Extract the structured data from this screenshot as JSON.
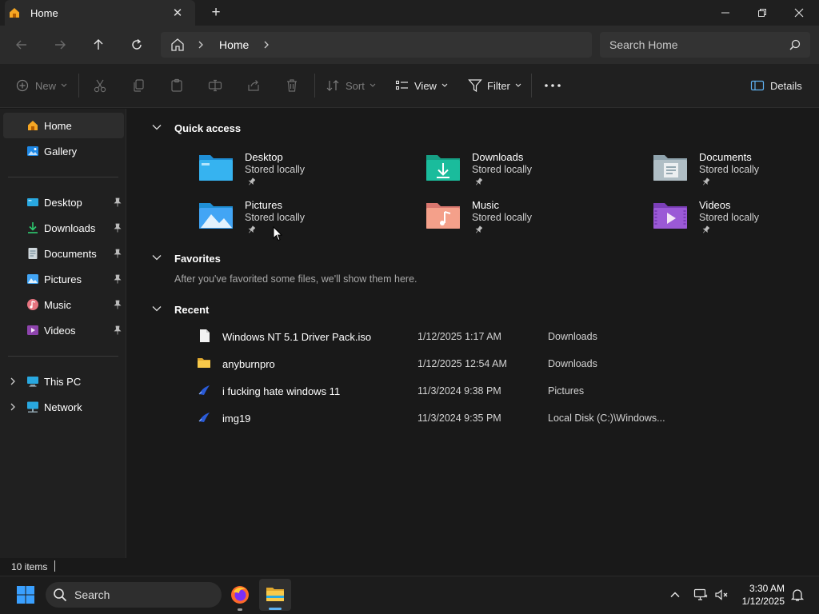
{
  "window": {
    "tab_title": "Home",
    "colors": {
      "accent": "#5fb2f2",
      "background": "#191919",
      "panel": "#202020"
    }
  },
  "addressbar": {
    "crumb": "Home",
    "search_placeholder": "Search Home"
  },
  "commandbar": {
    "new_label": "New",
    "sort_label": "Sort",
    "view_label": "View",
    "filter_label": "Filter",
    "details_label": "Details"
  },
  "sidebar": {
    "items": [
      {
        "label": "Home",
        "icon": "home-icon"
      },
      {
        "label": "Gallery",
        "icon": "gallery-icon"
      },
      {
        "label": "Desktop",
        "icon": "desktop-folder-icon"
      },
      {
        "label": "Downloads",
        "icon": "downloads-folder-icon"
      },
      {
        "label": "Documents",
        "icon": "documents-folder-icon"
      },
      {
        "label": "Pictures",
        "icon": "pictures-folder-icon"
      },
      {
        "label": "Music",
        "icon": "music-folder-icon"
      },
      {
        "label": "Videos",
        "icon": "videos-folder-icon"
      },
      {
        "label": "This PC",
        "icon": "pc-icon"
      },
      {
        "label": "Network",
        "icon": "network-icon"
      }
    ]
  },
  "main": {
    "quick_access": {
      "title": "Quick access",
      "items": [
        {
          "name": "Desktop",
          "sub": "Stored locally"
        },
        {
          "name": "Downloads",
          "sub": "Stored locally"
        },
        {
          "name": "Documents",
          "sub": "Stored locally"
        },
        {
          "name": "Pictures",
          "sub": "Stored locally"
        },
        {
          "name": "Music",
          "sub": "Stored locally"
        },
        {
          "name": "Videos",
          "sub": "Stored locally"
        }
      ]
    },
    "favorites": {
      "title": "Favorites",
      "empty": "After you've favorited some files, we'll show them here."
    },
    "recent": {
      "title": "Recent",
      "rows": [
        {
          "name": "Windows NT 5.1 Driver Pack.iso",
          "date": "1/12/2025 1:17 AM",
          "location": "Downloads",
          "icon": "file-icon"
        },
        {
          "name": "anyburnpro",
          "date": "1/12/2025 12:54 AM",
          "location": "Downloads",
          "icon": "folder-icon"
        },
        {
          "name": "i fucking hate windows 11",
          "date": "11/3/2024 9:38 PM",
          "location": "Pictures",
          "icon": "image-file-icon"
        },
        {
          "name": "img19",
          "date": "11/3/2024 9:35 PM",
          "location": "Local Disk (C:)\\Windows...",
          "icon": "image-file-icon"
        }
      ]
    }
  },
  "statusbar": {
    "count": "10 items"
  },
  "taskbar": {
    "search_label": "Search",
    "time": "3:30 AM",
    "date": "1/12/2025"
  }
}
